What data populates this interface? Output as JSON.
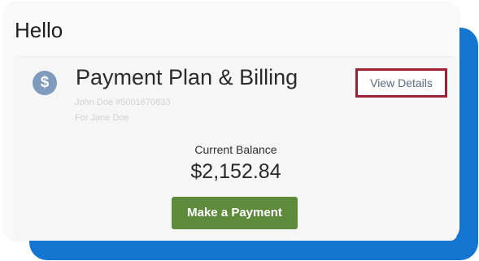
{
  "greeting": "Hello",
  "billing": {
    "title": "Payment Plan & Billing",
    "account_line": "John Doe #5001670833",
    "for_line": "For Jane Doe",
    "view_details_label": "View Details",
    "icon": "dollar-sign-icon",
    "icon_glyph": "$"
  },
  "balance": {
    "label": "Current Balance",
    "amount": "$2,152.84"
  },
  "actions": {
    "make_payment_label": "Make a Payment"
  },
  "colors": {
    "backdrop_blue": "#1576d2",
    "payment_button_green": "#5e8a3c",
    "details_border_red": "#9a2336",
    "icon_blue": "#7e9bbd"
  }
}
